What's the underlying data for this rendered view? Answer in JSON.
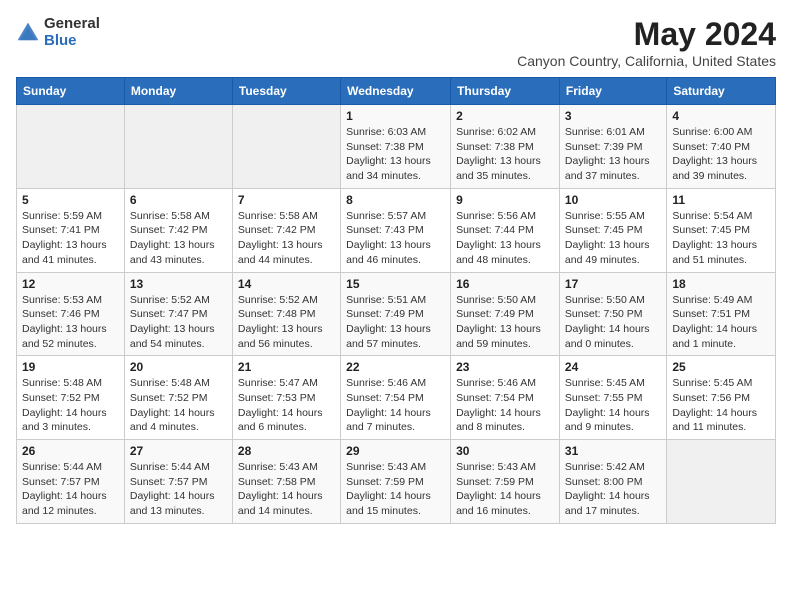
{
  "logo": {
    "general": "General",
    "blue": "Blue"
  },
  "title": {
    "month": "May 2024",
    "location": "Canyon Country, California, United States"
  },
  "calendar": {
    "headers": [
      "Sunday",
      "Monday",
      "Tuesday",
      "Wednesday",
      "Thursday",
      "Friday",
      "Saturday"
    ],
    "weeks": [
      [
        {
          "date": "",
          "sunrise": "",
          "sunset": "",
          "daylight": "",
          "empty": true
        },
        {
          "date": "",
          "sunrise": "",
          "sunset": "",
          "daylight": "",
          "empty": true
        },
        {
          "date": "",
          "sunrise": "",
          "sunset": "",
          "daylight": "",
          "empty": true
        },
        {
          "date": "1",
          "sunrise": "Sunrise: 6:03 AM",
          "sunset": "Sunset: 7:38 PM",
          "daylight": "Daylight: 13 hours and 34 minutes."
        },
        {
          "date": "2",
          "sunrise": "Sunrise: 6:02 AM",
          "sunset": "Sunset: 7:38 PM",
          "daylight": "Daylight: 13 hours and 35 minutes."
        },
        {
          "date": "3",
          "sunrise": "Sunrise: 6:01 AM",
          "sunset": "Sunset: 7:39 PM",
          "daylight": "Daylight: 13 hours and 37 minutes."
        },
        {
          "date": "4",
          "sunrise": "Sunrise: 6:00 AM",
          "sunset": "Sunset: 7:40 PM",
          "daylight": "Daylight: 13 hours and 39 minutes."
        }
      ],
      [
        {
          "date": "5",
          "sunrise": "Sunrise: 5:59 AM",
          "sunset": "Sunset: 7:41 PM",
          "daylight": "Daylight: 13 hours and 41 minutes."
        },
        {
          "date": "6",
          "sunrise": "Sunrise: 5:58 AM",
          "sunset": "Sunset: 7:42 PM",
          "daylight": "Daylight: 13 hours and 43 minutes."
        },
        {
          "date": "7",
          "sunrise": "Sunrise: 5:58 AM",
          "sunset": "Sunset: 7:42 PM",
          "daylight": "Daylight: 13 hours and 44 minutes."
        },
        {
          "date": "8",
          "sunrise": "Sunrise: 5:57 AM",
          "sunset": "Sunset: 7:43 PM",
          "daylight": "Daylight: 13 hours and 46 minutes."
        },
        {
          "date": "9",
          "sunrise": "Sunrise: 5:56 AM",
          "sunset": "Sunset: 7:44 PM",
          "daylight": "Daylight: 13 hours and 48 minutes."
        },
        {
          "date": "10",
          "sunrise": "Sunrise: 5:55 AM",
          "sunset": "Sunset: 7:45 PM",
          "daylight": "Daylight: 13 hours and 49 minutes."
        },
        {
          "date": "11",
          "sunrise": "Sunrise: 5:54 AM",
          "sunset": "Sunset: 7:45 PM",
          "daylight": "Daylight: 13 hours and 51 minutes."
        }
      ],
      [
        {
          "date": "12",
          "sunrise": "Sunrise: 5:53 AM",
          "sunset": "Sunset: 7:46 PM",
          "daylight": "Daylight: 13 hours and 52 minutes."
        },
        {
          "date": "13",
          "sunrise": "Sunrise: 5:52 AM",
          "sunset": "Sunset: 7:47 PM",
          "daylight": "Daylight: 13 hours and 54 minutes."
        },
        {
          "date": "14",
          "sunrise": "Sunrise: 5:52 AM",
          "sunset": "Sunset: 7:48 PM",
          "daylight": "Daylight: 13 hours and 56 minutes."
        },
        {
          "date": "15",
          "sunrise": "Sunrise: 5:51 AM",
          "sunset": "Sunset: 7:49 PM",
          "daylight": "Daylight: 13 hours and 57 minutes."
        },
        {
          "date": "16",
          "sunrise": "Sunrise: 5:50 AM",
          "sunset": "Sunset: 7:49 PM",
          "daylight": "Daylight: 13 hours and 59 minutes."
        },
        {
          "date": "17",
          "sunrise": "Sunrise: 5:50 AM",
          "sunset": "Sunset: 7:50 PM",
          "daylight": "Daylight: 14 hours and 0 minutes."
        },
        {
          "date": "18",
          "sunrise": "Sunrise: 5:49 AM",
          "sunset": "Sunset: 7:51 PM",
          "daylight": "Daylight: 14 hours and 1 minute."
        }
      ],
      [
        {
          "date": "19",
          "sunrise": "Sunrise: 5:48 AM",
          "sunset": "Sunset: 7:52 PM",
          "daylight": "Daylight: 14 hours and 3 minutes."
        },
        {
          "date": "20",
          "sunrise": "Sunrise: 5:48 AM",
          "sunset": "Sunset: 7:52 PM",
          "daylight": "Daylight: 14 hours and 4 minutes."
        },
        {
          "date": "21",
          "sunrise": "Sunrise: 5:47 AM",
          "sunset": "Sunset: 7:53 PM",
          "daylight": "Daylight: 14 hours and 6 minutes."
        },
        {
          "date": "22",
          "sunrise": "Sunrise: 5:46 AM",
          "sunset": "Sunset: 7:54 PM",
          "daylight": "Daylight: 14 hours and 7 minutes."
        },
        {
          "date": "23",
          "sunrise": "Sunrise: 5:46 AM",
          "sunset": "Sunset: 7:54 PM",
          "daylight": "Daylight: 14 hours and 8 minutes."
        },
        {
          "date": "24",
          "sunrise": "Sunrise: 5:45 AM",
          "sunset": "Sunset: 7:55 PM",
          "daylight": "Daylight: 14 hours and 9 minutes."
        },
        {
          "date": "25",
          "sunrise": "Sunrise: 5:45 AM",
          "sunset": "Sunset: 7:56 PM",
          "daylight": "Daylight: 14 hours and 11 minutes."
        }
      ],
      [
        {
          "date": "26",
          "sunrise": "Sunrise: 5:44 AM",
          "sunset": "Sunset: 7:57 PM",
          "daylight": "Daylight: 14 hours and 12 minutes."
        },
        {
          "date": "27",
          "sunrise": "Sunrise: 5:44 AM",
          "sunset": "Sunset: 7:57 PM",
          "daylight": "Daylight: 14 hours and 13 minutes."
        },
        {
          "date": "28",
          "sunrise": "Sunrise: 5:43 AM",
          "sunset": "Sunset: 7:58 PM",
          "daylight": "Daylight: 14 hours and 14 minutes."
        },
        {
          "date": "29",
          "sunrise": "Sunrise: 5:43 AM",
          "sunset": "Sunset: 7:59 PM",
          "daylight": "Daylight: 14 hours and 15 minutes."
        },
        {
          "date": "30",
          "sunrise": "Sunrise: 5:43 AM",
          "sunset": "Sunset: 7:59 PM",
          "daylight": "Daylight: 14 hours and 16 minutes."
        },
        {
          "date": "31",
          "sunrise": "Sunrise: 5:42 AM",
          "sunset": "Sunset: 8:00 PM",
          "daylight": "Daylight: 14 hours and 17 minutes."
        },
        {
          "date": "",
          "sunrise": "",
          "sunset": "",
          "daylight": "",
          "empty": true
        }
      ]
    ]
  }
}
